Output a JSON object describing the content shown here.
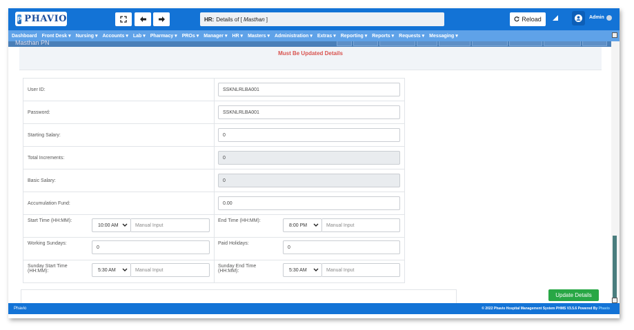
{
  "header": {
    "logo_text": "PHAVIO",
    "logo_mark": "P",
    "title_prefix": "HR:",
    "title_text": "Details of [",
    "title_name": "Masthan",
    "title_suffix": "]",
    "reload_label": "Reload",
    "user_label": "Admin",
    "accent_color": "#1373d6"
  },
  "menu": [
    "Dashboard",
    "Front Desk ▾",
    "Nursing ▾",
    "Accounts ▾",
    "Lab ▾",
    "Pharmacy ▾",
    "PROs ▾",
    "Manager ▾",
    "HR ▾",
    "Masters ▾",
    "Administration ▾",
    "Extras ▾",
    "Reporting ▾",
    "Reports ▾",
    "Requests ▾",
    "Messaging ▾"
  ],
  "subheader": {
    "title": "Masthan PN"
  },
  "notice": "Must Be Updated Details",
  "form": {
    "user_id": {
      "label": "User ID:",
      "value": "SSKNLRLBA001"
    },
    "password": {
      "label": "Password:",
      "value": "SSKNLRLBA001"
    },
    "starting_salary": {
      "label": "Starting Salary:",
      "value": "0"
    },
    "total_increments": {
      "label": "Total Increments:",
      "value": "0"
    },
    "basic_salary": {
      "label": "Basic Salary:",
      "value": "0"
    },
    "accumulation_fund": {
      "label": "Accumulation Fund:",
      "value": "0.00"
    },
    "start_time": {
      "label": "Start Time (HH:MM):",
      "value": "10:00 AM",
      "placeholder": "Manual Input"
    },
    "end_time": {
      "label": "End Time (HH:MM):",
      "value": "8:00 PM",
      "placeholder": "Manual Input"
    },
    "working_sundays": {
      "label": "Working Sundays:",
      "value": "0"
    },
    "paid_holidays": {
      "label": "Paid Holidays:",
      "value": "0"
    },
    "sunday_start_time": {
      "label_line1": "Sunday Start Time",
      "label_line2": "(HH:MM):",
      "value": "5:30 AM",
      "placeholder": "Manual Input"
    },
    "sunday_end_time": {
      "label_line1": "Sunday End Time",
      "label_line2": "(HH:MM):",
      "value": "5:30 AM",
      "placeholder": "Manual Input"
    }
  },
  "update_button": "Update Details",
  "footer": {
    "left": "Phavio",
    "right": "© 2022 Phavio Hospital Management System PHMS V3.5.6 Powered By",
    "brand": "Phavio"
  }
}
